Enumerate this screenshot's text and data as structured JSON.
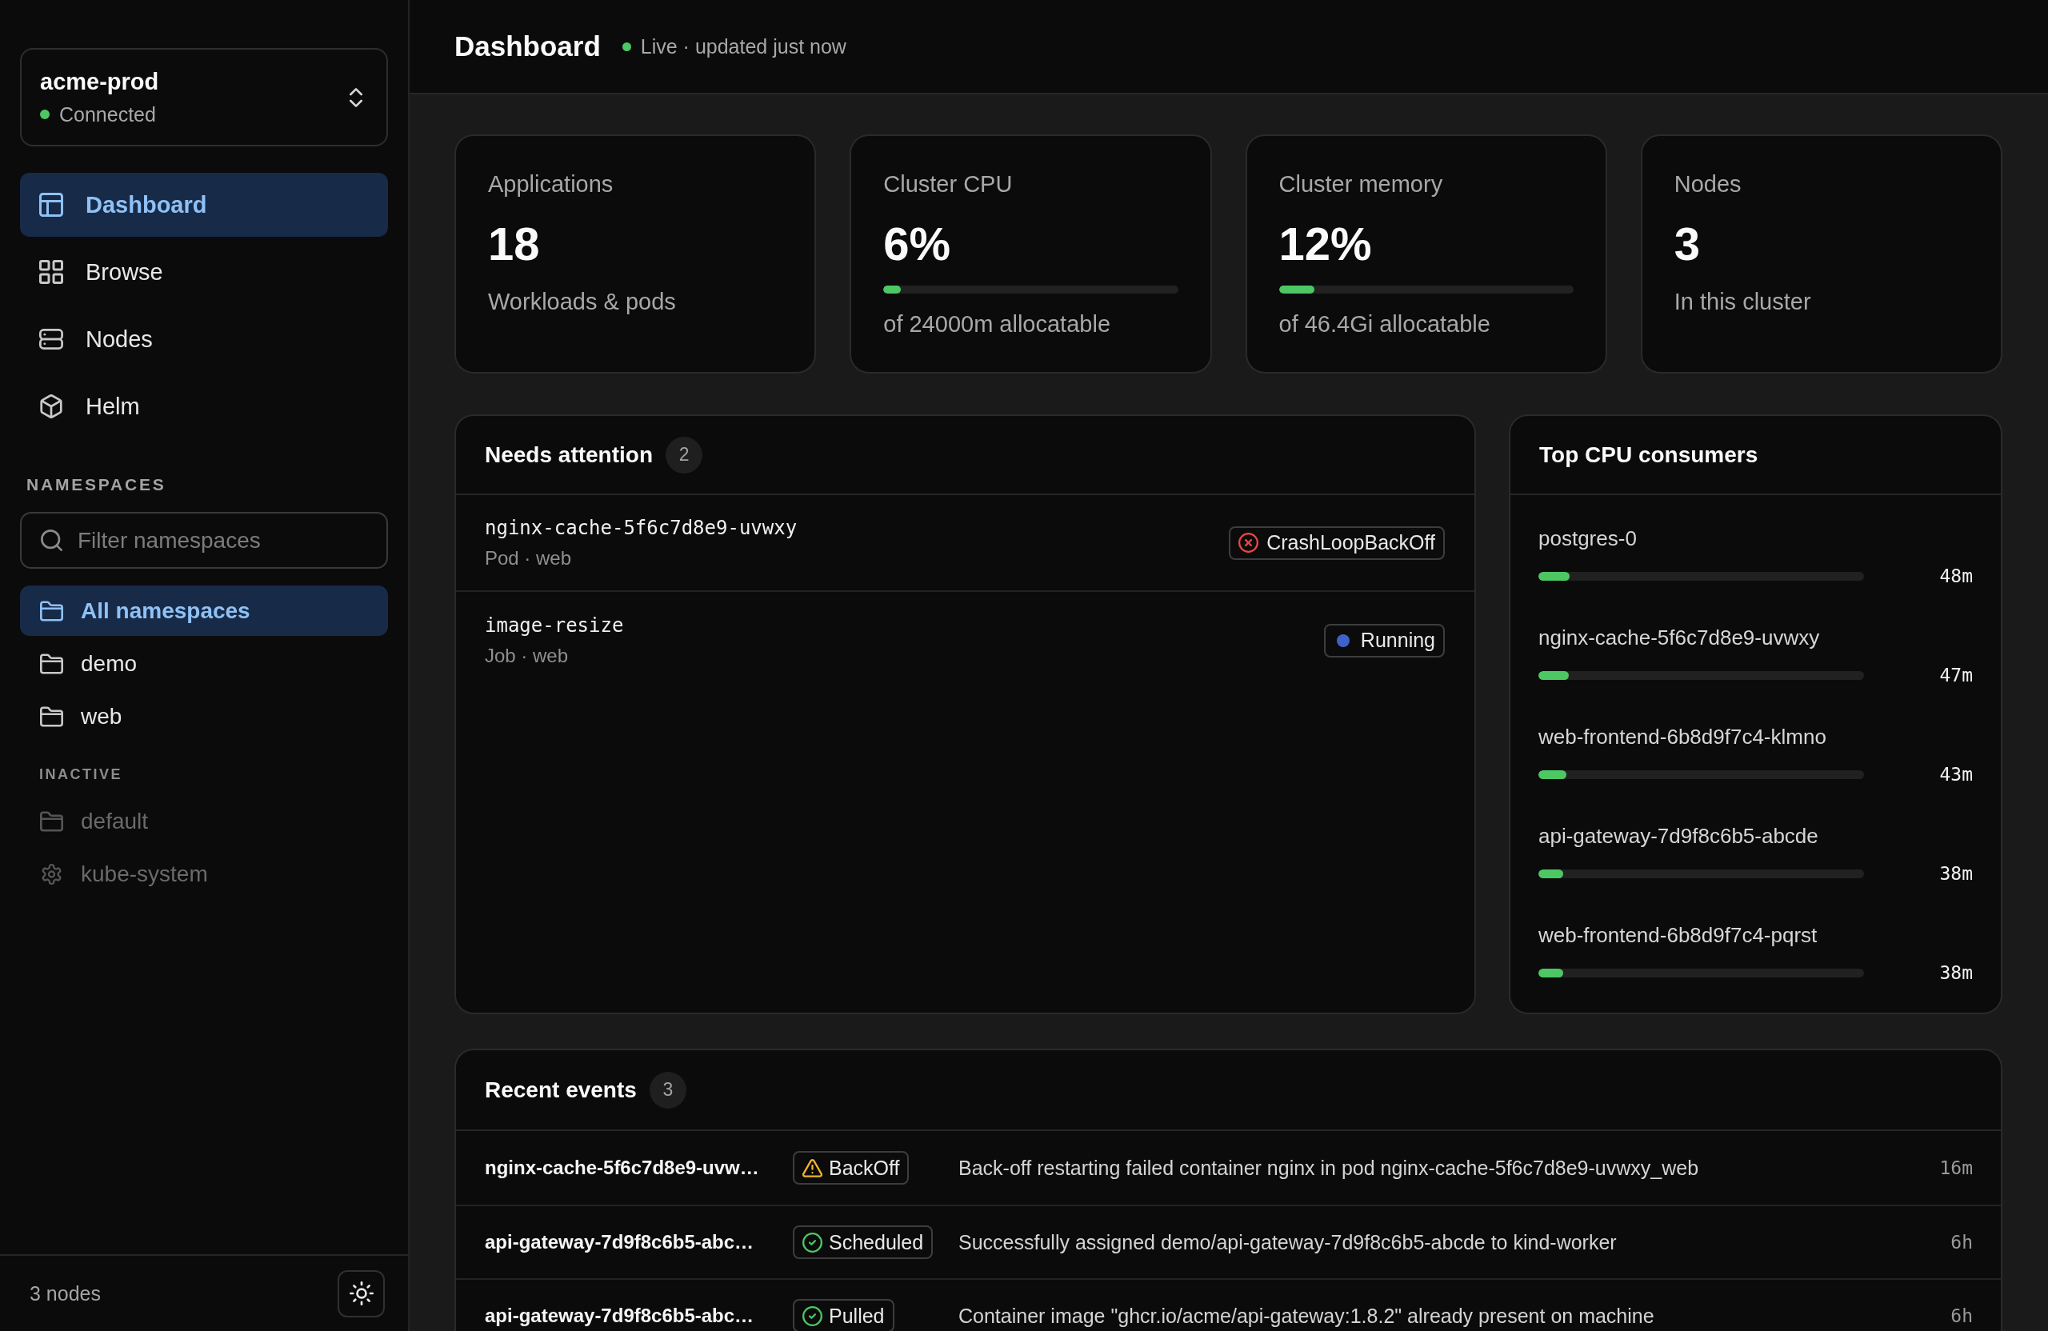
{
  "sidebar": {
    "cluster": {
      "name": "acme-prod",
      "status": "Connected",
      "connected": true
    },
    "nav": [
      {
        "label": "Dashboard",
        "selected": true
      },
      {
        "label": "Browse",
        "selected": false
      },
      {
        "label": "Nodes",
        "selected": false
      },
      {
        "label": "Helm",
        "selected": false
      }
    ],
    "namespaces": {
      "heading": "NAMESPACES",
      "filter": {
        "placeholder": "Filter namespaces"
      },
      "items": [
        {
          "label": "All namespaces",
          "selected": true
        },
        {
          "label": "demo",
          "selected": false
        },
        {
          "label": "web",
          "selected": false
        }
      ],
      "inactive_heading": "INACTIVE",
      "inactive_items": [
        {
          "label": "default",
          "kind": "namespace"
        },
        {
          "label": "kube-system",
          "kind": "system"
        }
      ]
    },
    "footer": {
      "node_count": "3 nodes"
    }
  },
  "header": {
    "title": "Dashboard",
    "status": "Live · updated just now",
    "live": true
  },
  "stats": [
    {
      "kind": "count",
      "label": "Applications",
      "value": "18",
      "caption": "Workloads & pods"
    },
    {
      "kind": "meter",
      "label": "Cluster CPU",
      "value": "6%",
      "level": 0.06,
      "caption": "of 24000m allocatable"
    },
    {
      "kind": "meter",
      "label": "Cluster memory",
      "value": "12%",
      "level": 0.12,
      "caption": "of 46.4Gi allocatable"
    },
    {
      "kind": "count",
      "label": "Nodes",
      "value": "3",
      "caption": "In this cluster"
    }
  ],
  "needs_attention": {
    "title": "Needs attention",
    "count": "2",
    "items": [
      {
        "name": "nginx-cache-5f6c7d8e9-uvwxy",
        "detail": "Pod · web",
        "status": "CrashLoopBackOff",
        "kind": "error"
      },
      {
        "name": "image-resize",
        "detail": "Job · web",
        "status": "Running",
        "kind": "running"
      }
    ]
  },
  "top_cpu": {
    "title": "Top CPU consumers",
    "items": [
      {
        "name": "postgres-0",
        "level": 0.096,
        "reading": "48m"
      },
      {
        "name": "nginx-cache-5f6c7d8e9-uvwxy",
        "level": 0.094,
        "reading": "47m"
      },
      {
        "name": "web-frontend-6b8d9f7c4-klmno",
        "level": 0.086,
        "reading": "43m"
      },
      {
        "name": "api-gateway-7d9f8c6b5-abcde",
        "level": 0.076,
        "reading": "38m"
      },
      {
        "name": "web-frontend-6b8d9f7c4-pqrst",
        "level": 0.076,
        "reading": "38m"
      }
    ]
  },
  "recent_events": {
    "title": "Recent events",
    "count": "3",
    "rows": [
      {
        "object": "nginx-cache-5f6c7d8e9-uvw…",
        "reason": "BackOff",
        "kind": "warning",
        "message": "Back-off restarting failed container nginx in pod nginx-cache-5f6c7d8e9-uvwxy_web",
        "age": "16m"
      },
      {
        "object": "api-gateway-7d9f8c6b5-abc…",
        "reason": "Scheduled",
        "kind": "normal",
        "message": "Successfully assigned demo/api-gateway-7d9f8c6b5-abcde to kind-worker",
        "age": "6h"
      },
      {
        "object": "api-gateway-7d9f8c6b5-abc…",
        "reason": "Pulled",
        "kind": "normal",
        "message": "Container image \"ghcr.io/acme/api-gateway:1.8.2\" already present on machine",
        "age": "6h"
      }
    ]
  }
}
